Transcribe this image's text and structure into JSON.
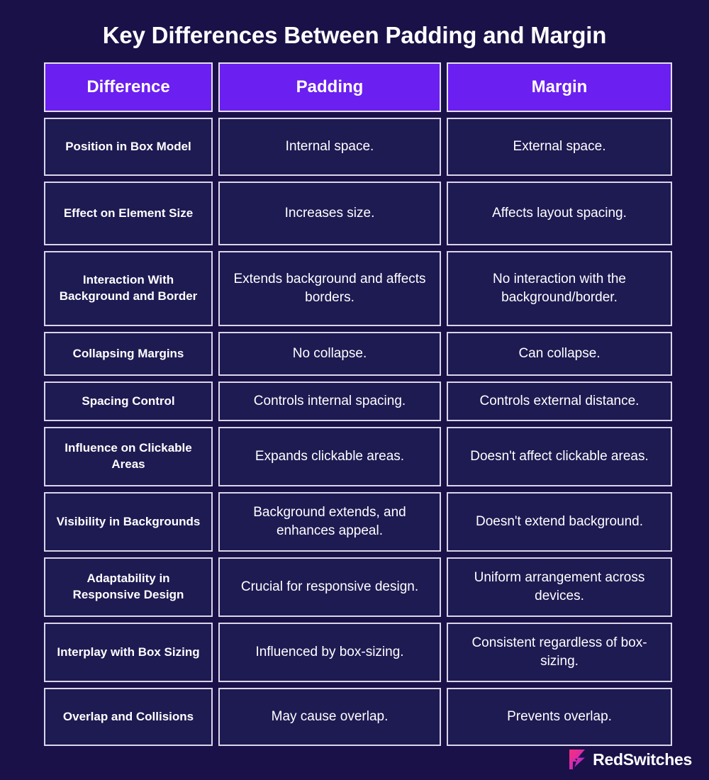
{
  "page": {
    "title": "Key Differences Between Padding and Margin",
    "background_color": "#1a1148",
    "accent_color": "#6b1ff0",
    "cell_background_color": "#1e1a52",
    "border_color": "#d9d5ea"
  },
  "table": {
    "headers": [
      "Difference",
      "Padding",
      "Margin"
    ],
    "rows": [
      {
        "difference": "Position in Box Model",
        "padding": "Internal space.",
        "margin": "External space."
      },
      {
        "difference": "Effect on Element Size",
        "padding": "Increases size.",
        "margin": "Affects layout spacing."
      },
      {
        "difference": "Interaction With Background and Border",
        "padding": "Extends background and affects borders.",
        "margin": "No interaction with the background/border."
      },
      {
        "difference": "Collapsing Margins",
        "padding": "No collapse.",
        "margin": "Can collapse."
      },
      {
        "difference": "Spacing Control",
        "padding": "Controls internal spacing.",
        "margin": "Controls external distance."
      },
      {
        "difference": "Influence on Clickable Areas",
        "padding": "Expands clickable areas.",
        "margin": "Doesn't affect clickable areas."
      },
      {
        "difference": "Visibility in Backgrounds",
        "padding": "Background extends, and enhances appeal.",
        "margin": "Doesn't extend background."
      },
      {
        "difference": "Adaptability in Responsive Design",
        "padding": "Crucial for responsive design.",
        "margin": "Uniform arrangement across devices."
      },
      {
        "difference": "Interplay with Box Sizing",
        "padding": "Influenced by box-sizing.",
        "margin": "Consistent regardless of box-sizing."
      },
      {
        "difference": "Overlap and Collisions",
        "padding": "May cause overlap.",
        "margin": "Prevents overlap."
      }
    ]
  },
  "footer": {
    "brand_name": "RedSwitches",
    "logo_icon": "redswitches-logo-icon",
    "logo_gradient_start": "#ff2d78",
    "logo_gradient_end": "#6b1ff0"
  }
}
